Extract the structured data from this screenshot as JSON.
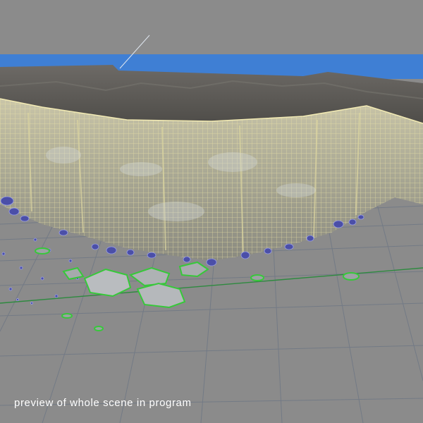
{
  "caption": "preview of whole scene in program",
  "colors": {
    "viewport_bg": "#8b8b8b",
    "sky_band": "#3f7fd4",
    "grid_lines": "#6f7885",
    "axis_line": "#2e8a3f",
    "wireframe": "#f1e7a8",
    "cliff_top": "#5e5c57",
    "rocks": "#4b4fa8",
    "selection_outline": "#37c83a"
  },
  "icons": {
    "cliff_mesh": "wireframe-mesh",
    "rock_debris": "rock-scatter",
    "selected_boulders": "selected-mesh"
  }
}
